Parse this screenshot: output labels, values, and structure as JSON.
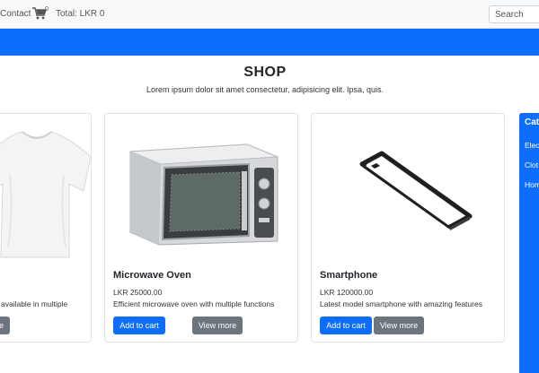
{
  "navbar": {
    "contact_label": "Contact",
    "cart_count": "0",
    "total_label": "Total: LKR 0",
    "search_placeholder": "Search"
  },
  "hero": {
    "title": "SHOP",
    "subtitle": "Lorem ipsum dolor sit amet consectetur, adipisicing elit. Ipsa, quis."
  },
  "products": [
    {
      "desc": "available in multiple",
      "view_label": "e",
      "image_icon": "tshirt-image"
    },
    {
      "title": "Microwave Oven",
      "price": "LKR 25000.00",
      "desc": "Efficient microwave oven with multiple functions",
      "add_label": "Add to cart",
      "view_label": "View more",
      "image_icon": "microwave-image"
    },
    {
      "title": "Smartphone",
      "price": "LKR 120000.00",
      "desc": "Latest model smartphone with amazing features",
      "add_label": "Add to cart",
      "view_label": "View more",
      "image_icon": "smartphone-image"
    }
  ],
  "sidebar": {
    "title": "Cat",
    "items": [
      "Elec",
      "Clot",
      "Hom"
    ]
  },
  "colors": {
    "primary": "#0d6efd",
    "secondary": "#6c757d",
    "navbar_bg": "#f8f9fa"
  }
}
